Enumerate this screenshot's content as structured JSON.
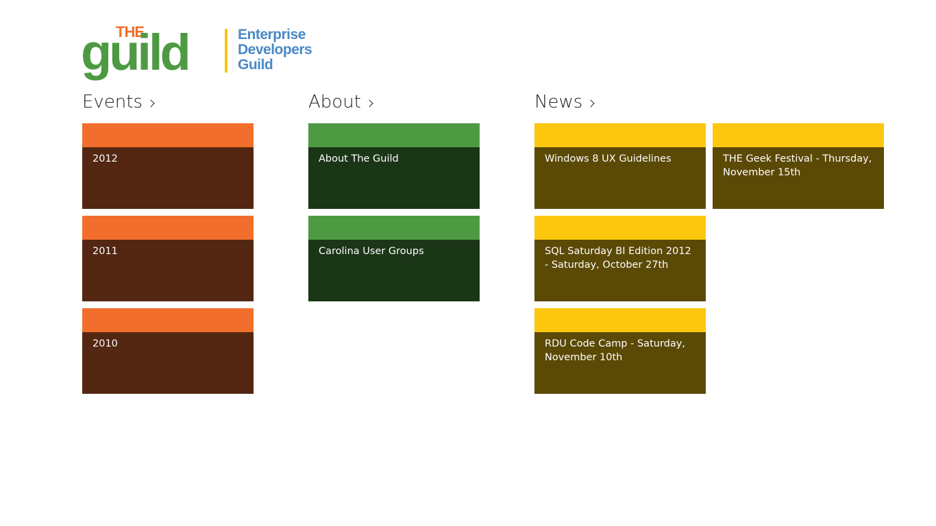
{
  "logo": {
    "the": "THE",
    "guild": "guild",
    "line1": "Enterprise",
    "line2": "Developers",
    "line3": "Guild",
    "colors": {
      "the": "#f26e2c",
      "guild": "#4e9a43",
      "bar": "#fbc60f",
      "text": "#4a88c6"
    }
  },
  "sections": {
    "events": {
      "title": "Events",
      "colors": {
        "band": "#f26e2c",
        "body": "#532711"
      },
      "items": [
        {
          "label": "2012"
        },
        {
          "label": "2011"
        },
        {
          "label": "2010"
        }
      ]
    },
    "about": {
      "title": "About",
      "colors": {
        "band": "#4e9a43",
        "body": "#1b3517"
      },
      "items": [
        {
          "label": "About The Guild"
        },
        {
          "label": "Carolina User Groups"
        }
      ]
    },
    "news": {
      "title": "News",
      "colors": {
        "band": "#fdc70f",
        "body": "#5b4906"
      },
      "items": [
        {
          "label": "Windows 8 UX Guidelines"
        },
        {
          "label": "SQL Saturday BI Edition 2012 - Saturday, October 27th"
        },
        {
          "label": "RDU Code Camp - Saturday, November 10th"
        },
        {
          "label": "THE Geek Festival - Thursday, November 15th"
        }
      ]
    }
  }
}
